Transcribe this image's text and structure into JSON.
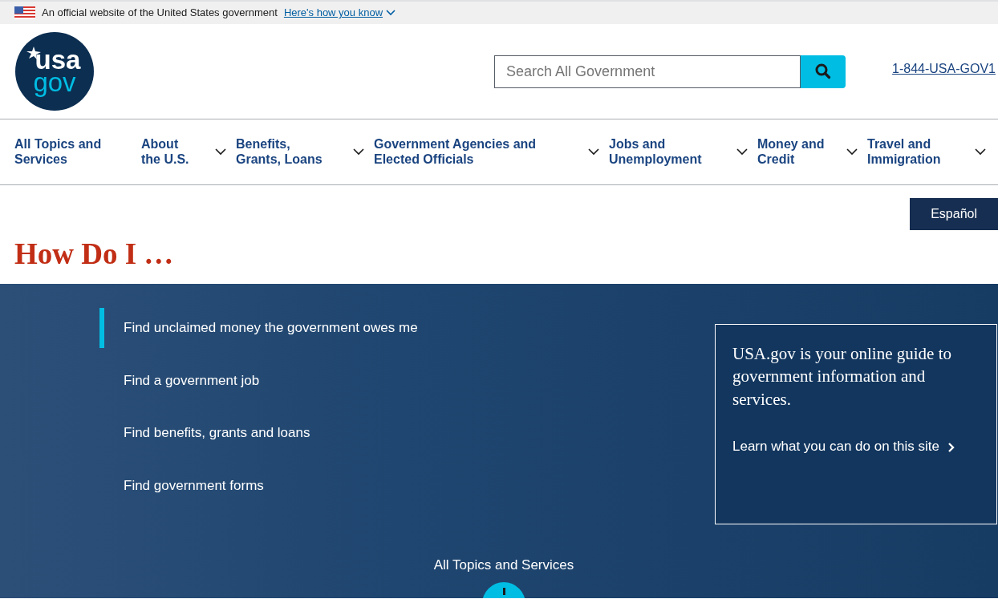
{
  "banner": {
    "text": "An official website of the United States government",
    "link": "Here's how you know"
  },
  "header": {
    "logo_top": "usa",
    "logo_bottom": "gov",
    "search": {
      "placeholder": "Search All Government"
    },
    "phone": "1-844-USA-GOV1"
  },
  "nav": [
    {
      "label": "All Topics and Services",
      "dropdown": false
    },
    {
      "label": "About the U.S.",
      "dropdown": true
    },
    {
      "label": "Benefits, Grants, Loans",
      "dropdown": true
    },
    {
      "label": "Government Agencies and Elected Officials",
      "dropdown": true
    },
    {
      "label": "Jobs and Unemployment",
      "dropdown": true
    },
    {
      "label": "Money and Credit",
      "dropdown": true
    },
    {
      "label": "Travel and Immigration",
      "dropdown": true
    }
  ],
  "language_button": "Español",
  "heading": "How Do I …",
  "hero": {
    "links": [
      {
        "label": "Find unclaimed money the government owes me",
        "selected": true
      },
      {
        "label": "Find a government job",
        "selected": false
      },
      {
        "label": "Find benefits, grants and loans",
        "selected": false
      },
      {
        "label": "Find government forms",
        "selected": false
      }
    ],
    "card": {
      "text": "USA.gov is your online guide to government information and services.",
      "link": "Learn what you can do on this site"
    },
    "all_topics": "All Topics and Services"
  }
}
